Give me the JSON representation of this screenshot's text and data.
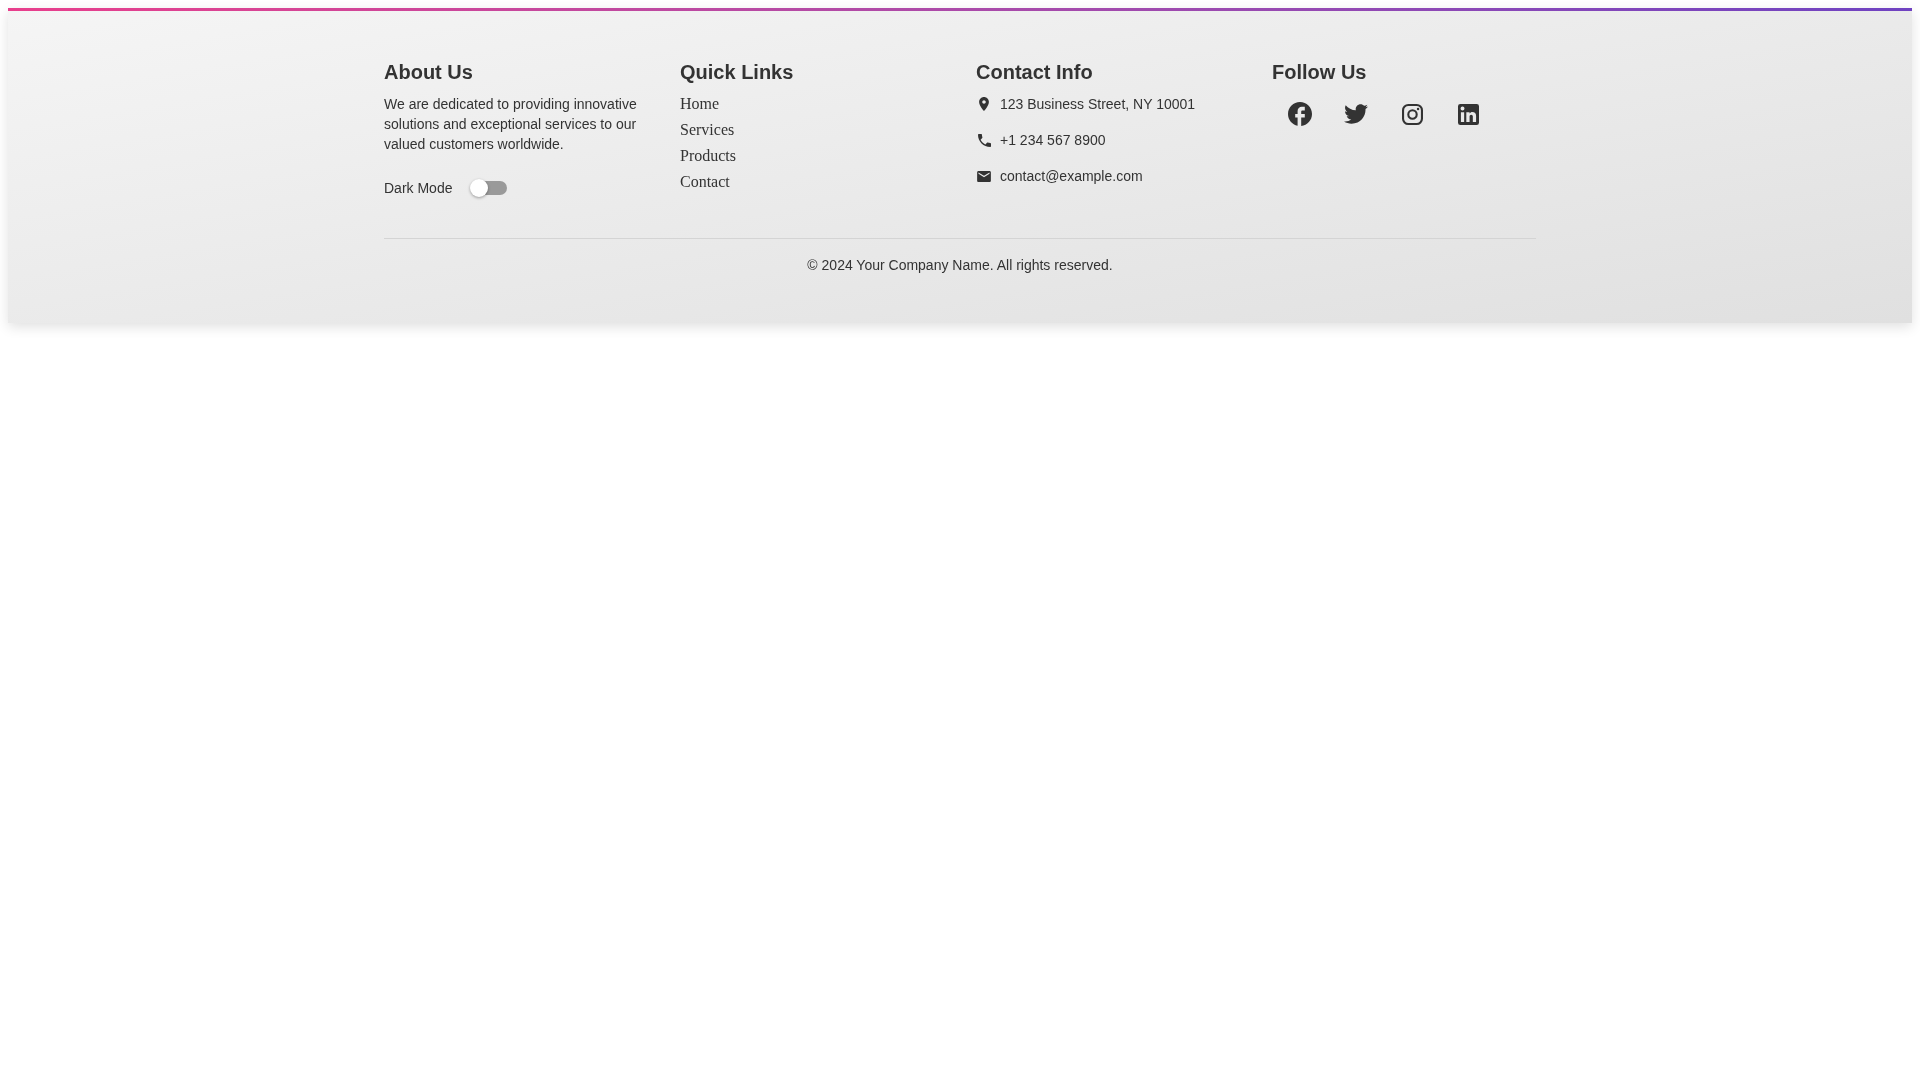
{
  "about": {
    "title": "About Us",
    "text": "We are dedicated to providing innovative solutions and exceptional services to our valued customers worldwide.",
    "dark_mode": {
      "label": "Dark Mode",
      "on": false
    }
  },
  "quick_links": {
    "title": "Quick Links",
    "links": [
      "Home",
      "Services",
      "Products",
      "Contact"
    ]
  },
  "contact_info": {
    "title": "Contact Info",
    "items": [
      {
        "kind": "address",
        "text": "123 Business Street, NY 10001"
      },
      {
        "kind": "phone",
        "text": "+1 234 567 8900"
      },
      {
        "kind": "email",
        "text": "contact@example.com"
      }
    ]
  },
  "follow_us": {
    "title": "Follow Us",
    "social": [
      {
        "kind": "facebook"
      },
      {
        "kind": "twitter"
      },
      {
        "kind": "instagram"
      },
      {
        "kind": "linkedin"
      }
    ]
  },
  "copyright": "© 2024 Your Company Name. All rights reserved."
}
